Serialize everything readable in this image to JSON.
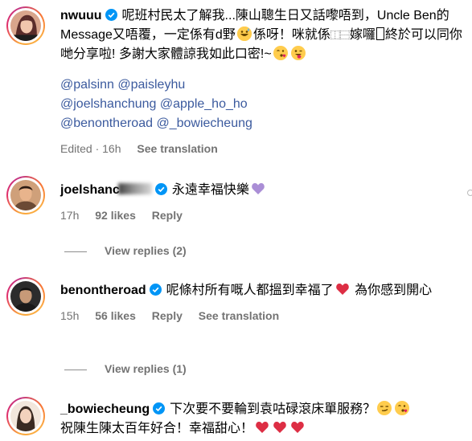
{
  "comments": [
    {
      "username": "nwuuu",
      "text1": "呢班村民太了解我...陳山聰生日又話嚟唔到，Uncle Ben的Message又唔覆，一定係有d野",
      "text2": "係呀！咪就係",
      "text3": "嫁囉",
      "text4": "終於可以同你哋分享啦! 多謝大家體諒我如此口密!~",
      "mentions": [
        "@palsinn @paisleyhu",
        "@joelshanchung @apple_ho_ho",
        "@benontheroad @_bowiecheung"
      ],
      "edited": "Edited · 16h",
      "see_translation": "See translation"
    },
    {
      "username": "joelshanc",
      "text": "永遠幸福快樂",
      "time": "17h",
      "likes": "92 likes",
      "reply": "Reply",
      "view_replies": "View replies (2)"
    },
    {
      "username": "benontheroad",
      "text1": "呢條村所有嘅人都搵到幸福了",
      "text2": "為你感到開心",
      "time": "15h",
      "likes": "56 likes",
      "reply": "Reply",
      "see_translation": "See translation",
      "view_replies": "View replies (1)"
    },
    {
      "username": "_bowiecheung",
      "text1": "下次要不要輪到袁咕碌滾床單服務？",
      "text2": "祝陳生陳太百年好合！幸福甜心！"
    }
  ],
  "icons": {
    "verified": "verified-badge-icon",
    "kiss": "kissing-face-emoji",
    "tongue": "winking-tongue-face-emoji",
    "grin": "grinning-sweat-emoji",
    "heart": "red-heart-emoji",
    "purple": "purple-heart-emoji",
    "smirk": "smirking-face-emoji",
    "hands": "folded-hands-emoji"
  },
  "colors": {
    "link": "#3b5a9e",
    "meta": "#737373",
    "verified": "#0095f6"
  }
}
